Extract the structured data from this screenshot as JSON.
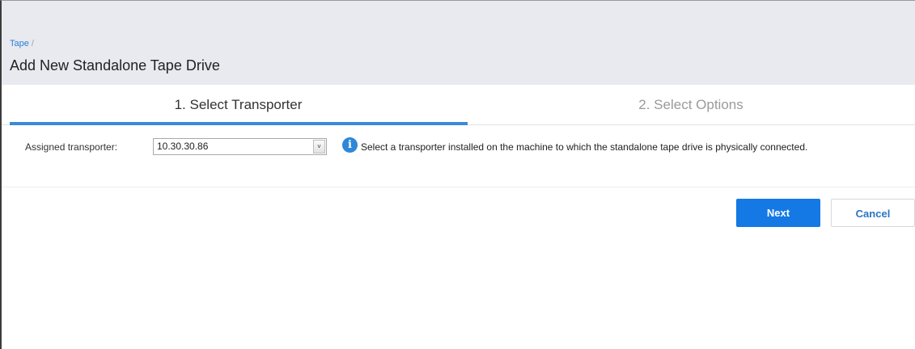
{
  "breadcrumb": {
    "link": "Tape",
    "separator": "/"
  },
  "page": {
    "title": "Add New Standalone Tape Drive"
  },
  "wizard": {
    "steps": [
      {
        "label": "1. Select Transporter",
        "active": true
      },
      {
        "label": "2. Select Options",
        "active": false
      }
    ]
  },
  "form": {
    "assigned_transporter_label": "Assigned transporter:",
    "assigned_transporter_value": "10.30.30.86",
    "dropdown_arrow": "˅",
    "info_icon": "i",
    "hint": "Select a transporter installed on the machine to which the standalone tape drive is physically connected."
  },
  "buttons": {
    "next": "Next",
    "cancel": "Cancel"
  },
  "colors": {
    "accent": "#3b8ad9",
    "primary_button": "#1479e4",
    "header_bg": "#e8eaf0",
    "link": "#2a7fd4"
  }
}
